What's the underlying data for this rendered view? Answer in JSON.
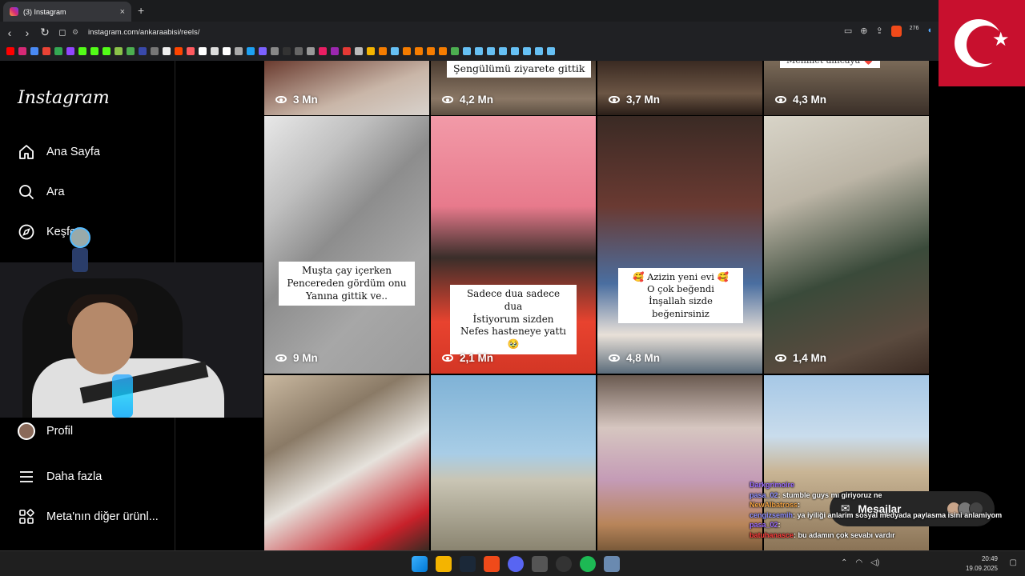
{
  "browser": {
    "tab_title": "(3) Instagram",
    "tab_close": "×",
    "new_tab": "+",
    "url": "instagram.com/ankaraabisi/reels/",
    "badge_count": "276"
  },
  "sidebar": {
    "logo": "Instagram",
    "items": [
      {
        "label": "Ana Sayfa"
      },
      {
        "label": "Ara"
      },
      {
        "label": "Keşfet"
      },
      {
        "label": "Profil"
      },
      {
        "label": "Daha fazla"
      },
      {
        "label": "Meta'nın diğer ürünl..."
      }
    ]
  },
  "reels": [
    {
      "views": "3 Mn",
      "caption": ""
    },
    {
      "views": "4,2 Mn",
      "caption": "Şengülümü ziyarete gittik"
    },
    {
      "views": "3,7 Mn",
      "caption": ""
    },
    {
      "views": "4,3 Mn",
      "caption": "Mehmet amcaya ❤️"
    },
    {
      "views": "9 Mn",
      "caption_lines": [
        "Muşta çay içerken",
        "Pencereden gördüm onu",
        "Yanına gittik ve.."
      ]
    },
    {
      "views": "2,1 Mn",
      "caption_lines": [
        "Sadece dua sadece dua",
        "İstiyorum sizden",
        "Nefes hasteneye yattı 🥹"
      ]
    },
    {
      "views": "4,8 Mn",
      "caption_lines": [
        "🥰  Azizin yeni evi  🥰",
        "O çok beğendi",
        "İnşallah sizde beğenirsiniz"
      ]
    },
    {
      "views": "1,4 Mn",
      "caption": ""
    },
    {
      "views": "",
      "caption": ""
    },
    {
      "views": "",
      "caption": ""
    },
    {
      "views": "",
      "caption": ""
    },
    {
      "views": "",
      "caption": ""
    }
  ],
  "messages": {
    "label": "Mesajlar"
  },
  "chat": [
    {
      "user": "Darkgrimoire",
      "text": ""
    },
    {
      "user": "pasa_02",
      "text": ": stumble guys mı giriyoruz ne"
    },
    {
      "user": "NewAlbatross",
      "text": ":"
    },
    {
      "user": "cengizsemih",
      "text": ": ya iyiliği anlarim      sosyal medyada paylasma isini anlamiyom"
    },
    {
      "user": "pasa_02",
      "text": ":"
    },
    {
      "user": "batuhanasce",
      "text": ": bu adamın çok sevabı vardır"
    }
  ],
  "clock": {
    "time": "20:49",
    "date": "19.09.2025"
  },
  "colors": {
    "instagram_bg": "#000000",
    "sidebar_border": "#262626",
    "flag_red": "#C8102E",
    "taskbar": "#1F1F1F"
  }
}
